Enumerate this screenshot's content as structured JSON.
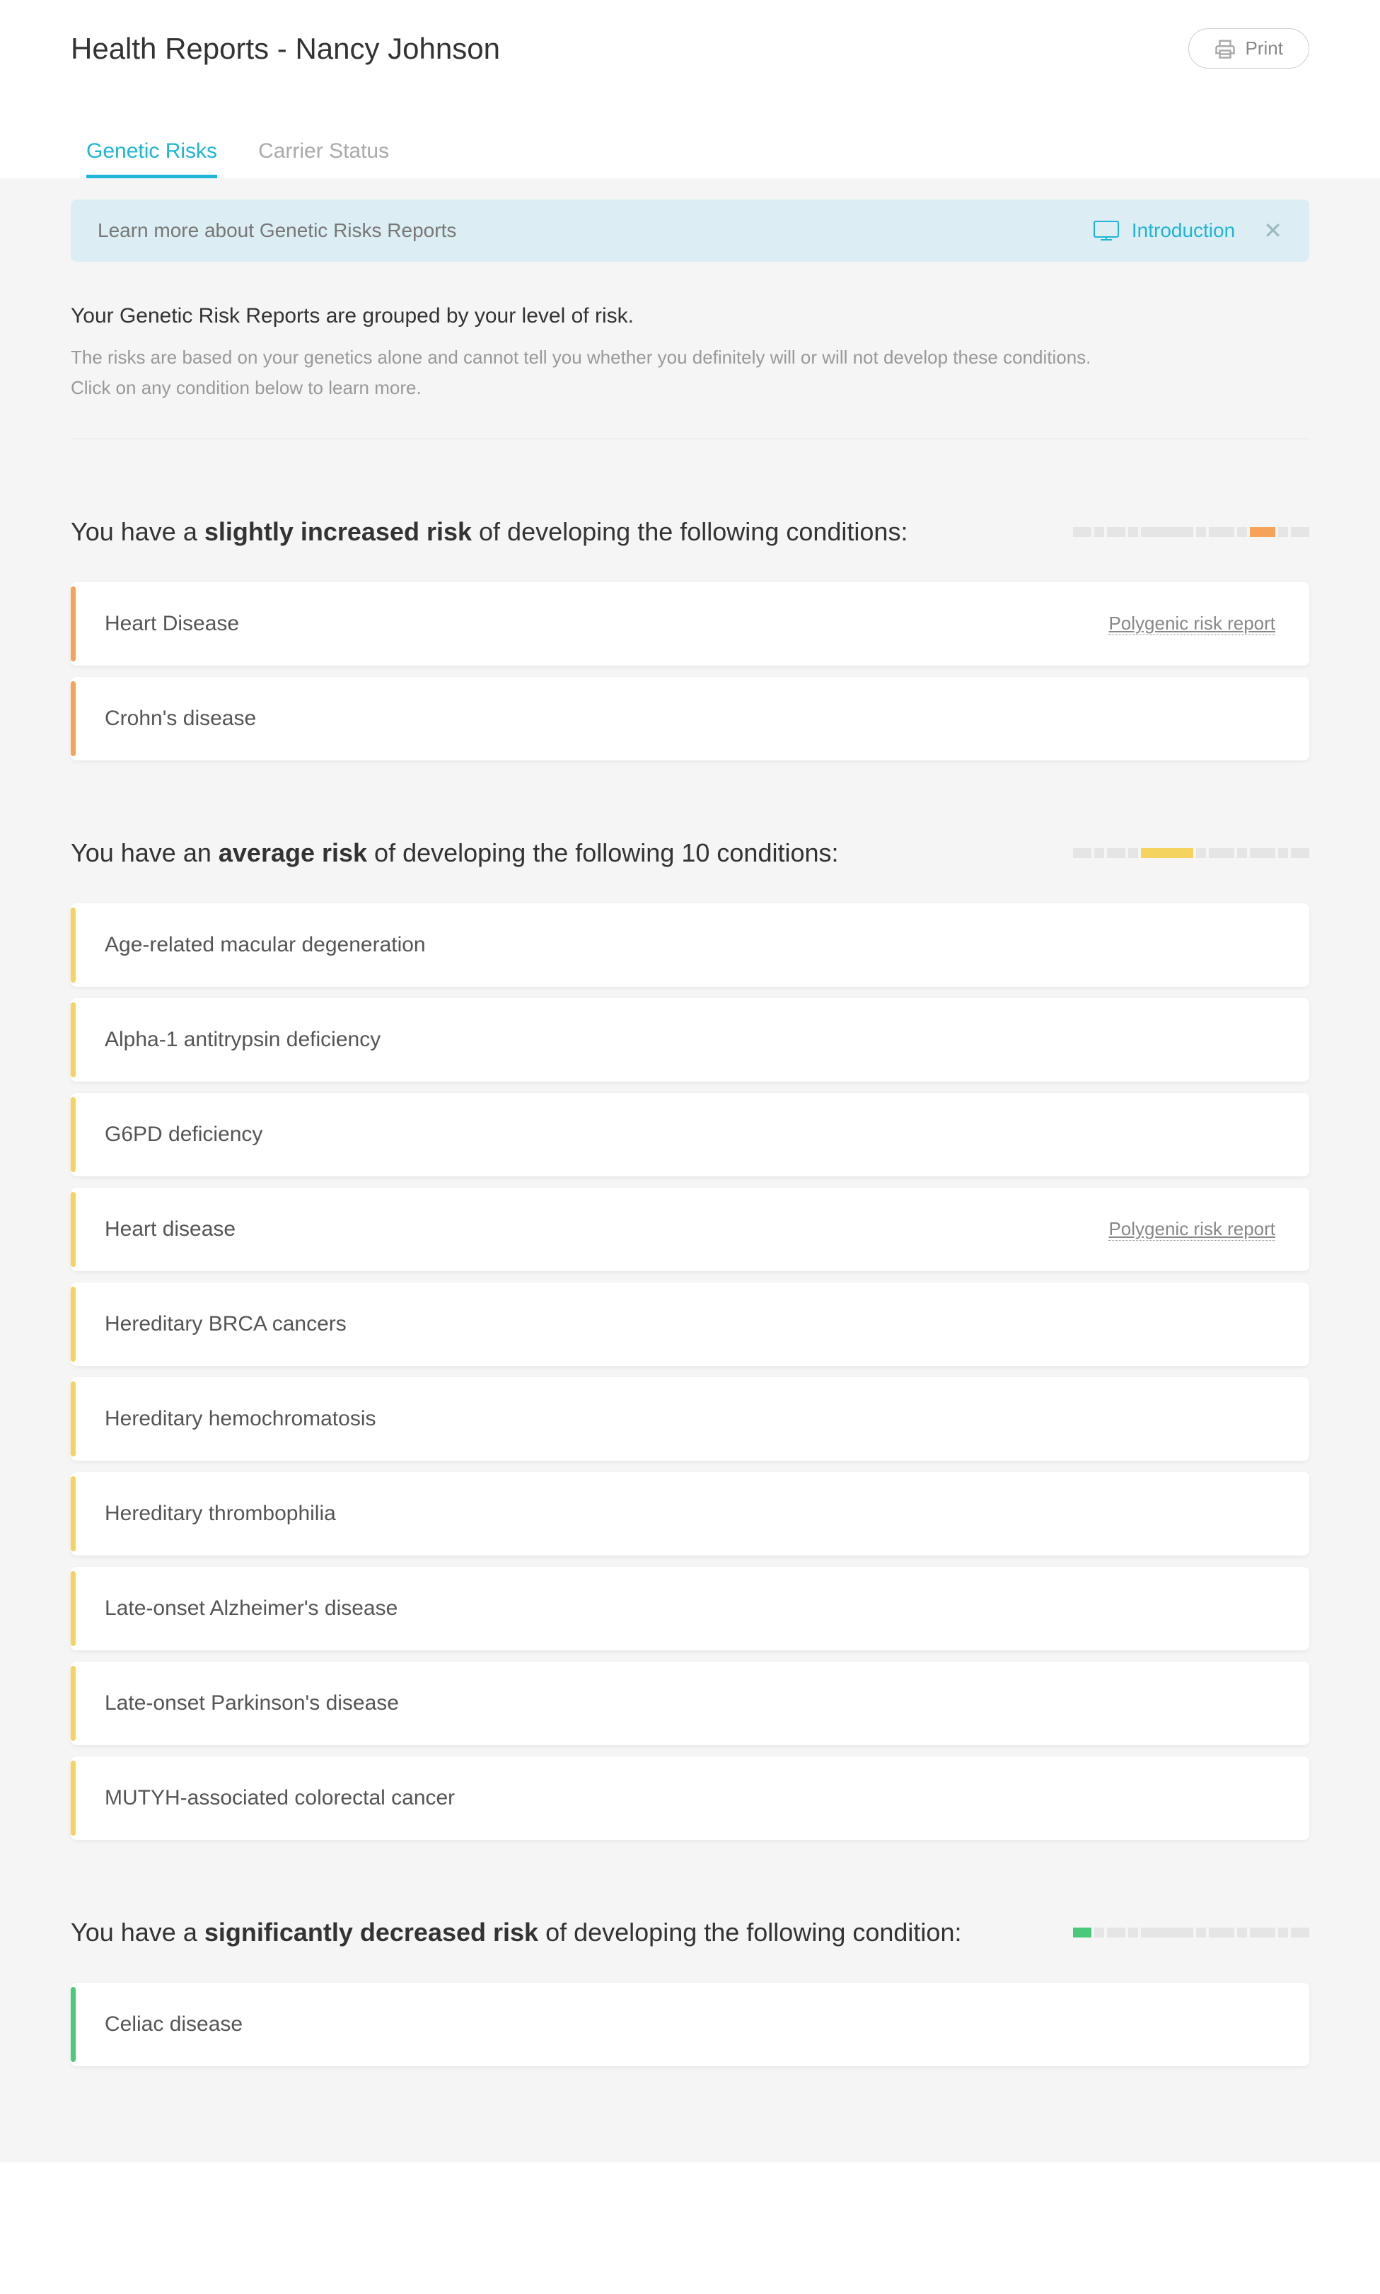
{
  "header": {
    "title": "Health Reports - Nancy Johnson",
    "print_label": "Print"
  },
  "tabs": {
    "genetic_risks": "Genetic Risks",
    "carrier_status": "Carrier Status"
  },
  "banner": {
    "text": "Learn more about Genetic Risks Reports",
    "intro_label": "Introduction"
  },
  "intro": {
    "title": "Your Genetic Risk Reports are grouped by your level of risk.",
    "line1": "The risks are based on your genetics alone and cannot tell you whether you definitely will or will not develop these conditions.",
    "line2": "Click on any condition below to learn more."
  },
  "polygenic_link_label": "Polygenic risk report",
  "sections": {
    "slightly_increased": {
      "prefix": "You have a ",
      "bold": "slightly increased risk",
      "suffix": " of developing the following conditions:",
      "items": [
        {
          "name": "Heart Disease",
          "polygenic": true
        },
        {
          "name": "Crohn's disease",
          "polygenic": false
        }
      ]
    },
    "average": {
      "prefix": "You have an ",
      "bold": "average risk",
      "suffix": " of developing the following 10 conditions:",
      "items": [
        {
          "name": "Age-related macular degeneration",
          "polygenic": false
        },
        {
          "name": "Alpha-1 antitrypsin deficiency",
          "polygenic": false
        },
        {
          "name": "G6PD deficiency",
          "polygenic": false
        },
        {
          "name": "Heart disease",
          "polygenic": true
        },
        {
          "name": "Hereditary BRCA cancers",
          "polygenic": false
        },
        {
          "name": "Hereditary hemochromatosis",
          "polygenic": false
        },
        {
          "name": "Hereditary thrombophilia",
          "polygenic": false
        },
        {
          "name": "Late-onset Alzheimer's disease",
          "polygenic": false
        },
        {
          "name": "Late-onset Parkinson's disease",
          "polygenic": false
        },
        {
          "name": "MUTYH-associated colorectal cancer",
          "polygenic": false
        }
      ]
    },
    "significantly_decreased": {
      "prefix": "You have a ",
      "bold": "significantly decreased risk",
      "suffix": " of developing the following condition:",
      "items": [
        {
          "name": "Celiac disease",
          "polygenic": false
        }
      ]
    }
  },
  "risk_scale": {
    "segment_widths": [
      26,
      14,
      26,
      14,
      74,
      14,
      36,
      14,
      36,
      14,
      26
    ],
    "slightly_increased_active_index": 8,
    "slightly_increased_color": "#f5a35a",
    "average_active_start": 4,
    "average_active_end": 4,
    "average_color": "#f4d35e",
    "decreased_active_index": 0,
    "decreased_color": "#4bc97a"
  }
}
